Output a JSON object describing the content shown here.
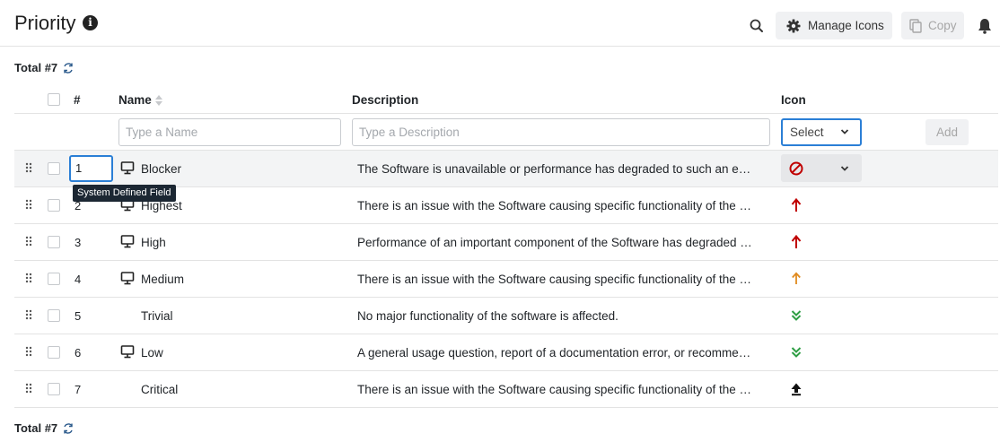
{
  "header": {
    "title": "Priority",
    "manage_icons_label": "Manage Icons",
    "copy_label": "Copy"
  },
  "totals": {
    "top": "Total #7",
    "bottom": "Total #7"
  },
  "columns": {
    "number": "#",
    "name": "Name",
    "description": "Description",
    "icon": "Icon"
  },
  "filters": {
    "name_placeholder": "Type a Name",
    "description_placeholder": "Type a Description",
    "icon_select": "Select",
    "add_label": "Add"
  },
  "tooltip": "System Defined Field",
  "rows": [
    {
      "order": "1",
      "name": "Blocker",
      "system": true,
      "description": "The Software is unavailable or performance has degraded to such an extent that it is unusable",
      "icon": "blocked-icon"
    },
    {
      "order": "2",
      "name": "Highest",
      "system": true,
      "description": "There is an issue with the Software causing specific functionality of the Software to be unavailable",
      "icon": "arrow-up-red-icon"
    },
    {
      "order": "3",
      "name": "High",
      "system": true,
      "description": "Performance of an important component of the Software has degraded for some users",
      "icon": "arrow-up-red-icon"
    },
    {
      "order": "4",
      "name": "Medium",
      "system": true,
      "description": "There is an issue with the Software causing specific functionality of the Software to behave unexpectedly",
      "icon": "arrow-up-orange-icon"
    },
    {
      "order": "5",
      "name": "Trivial",
      "system": false,
      "description": "No major functionality of the software is affected.",
      "icon": "double-chevron-down-green-icon"
    },
    {
      "order": "6",
      "name": "Low",
      "system": true,
      "description": "A general usage question, report of a documentation error, or recommendation for a future enhancement",
      "icon": "double-chevron-down-green-icon"
    },
    {
      "order": "7",
      "name": "Critical",
      "system": false,
      "description": "There is an issue with the Software causing specific functionality of the software to be unavailable",
      "icon": "arrow-up-bar-black-icon"
    }
  ],
  "colors": {
    "accent": "#2b7fd6",
    "red": "#c00000",
    "orange": "#e08a1e",
    "green": "#2e9e44"
  }
}
